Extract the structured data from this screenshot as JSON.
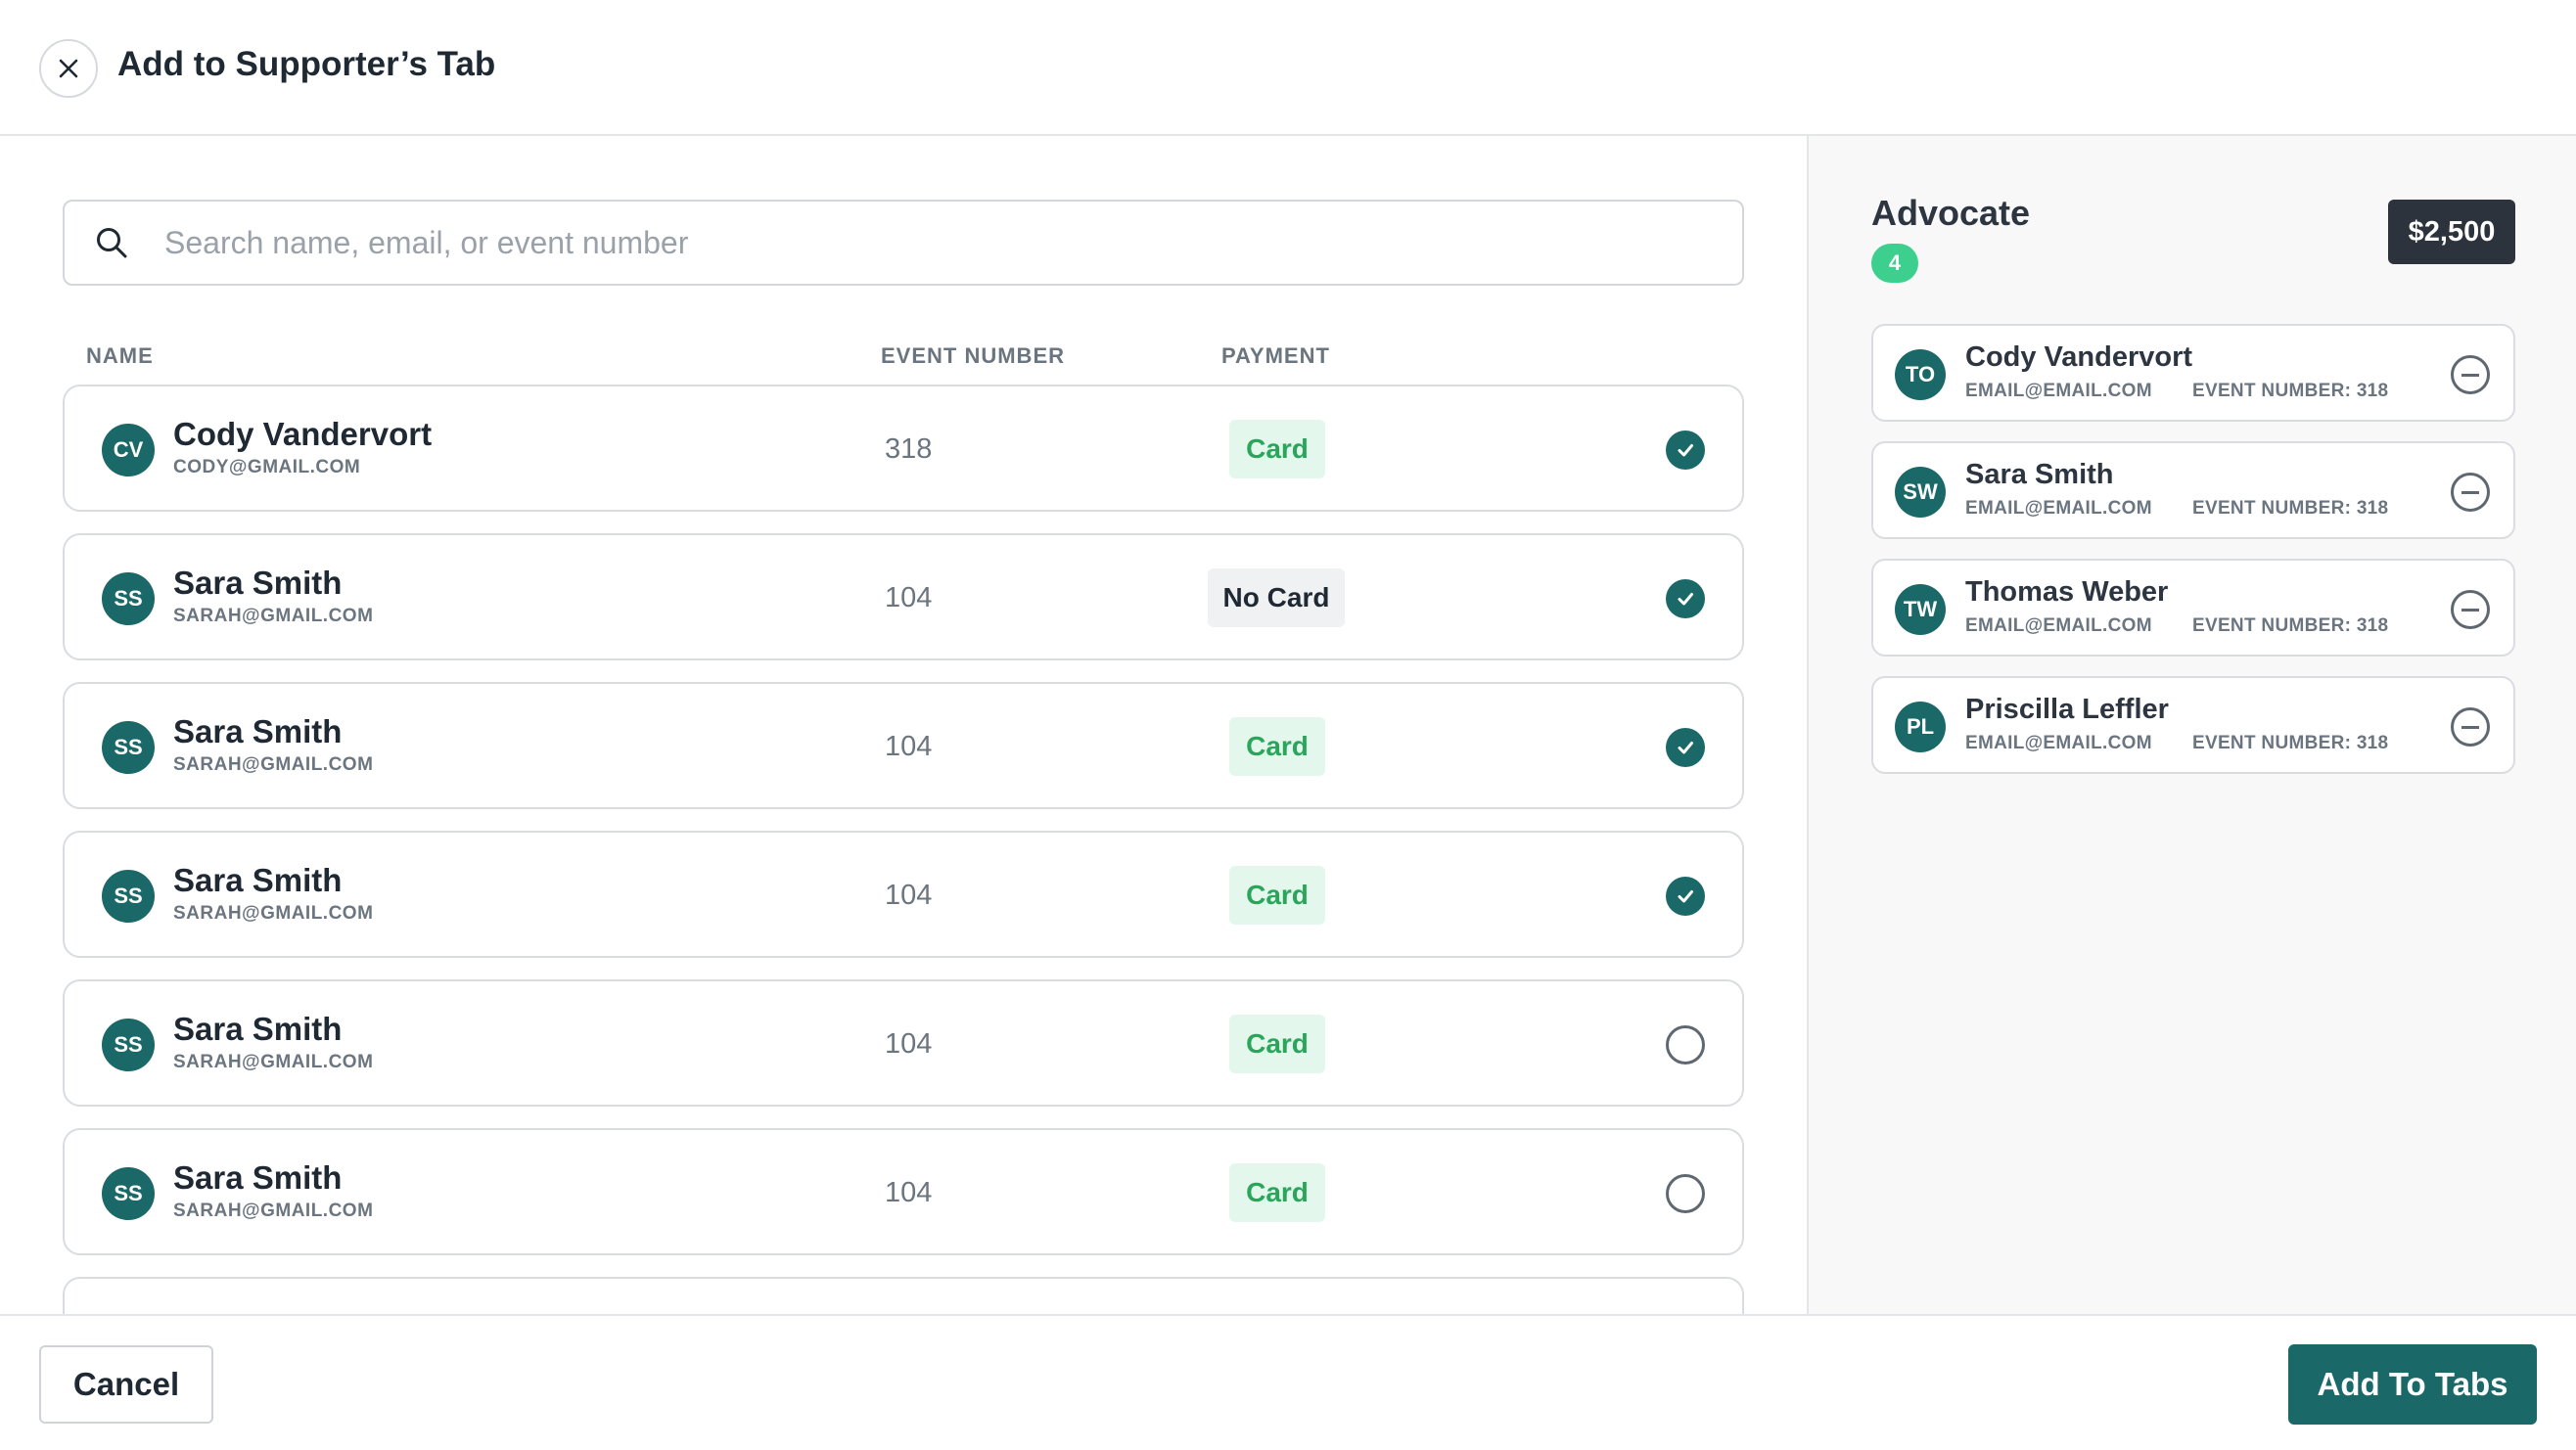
{
  "header": {
    "title": "Add to Supporter’s Tab",
    "close_icon": "close-icon"
  },
  "search": {
    "placeholder": "Search name, email, or event number",
    "value": ""
  },
  "table": {
    "columns": [
      "NAME",
      "EVENT NUMBER",
      "PAYMENT"
    ],
    "rows": [
      {
        "initials": "CV",
        "name": "Cody Vandervort",
        "email": "CODY@GMAIL.COM",
        "event_number": "318",
        "payment": "Card",
        "selected": true
      },
      {
        "initials": "SS",
        "name": "Sara Smith",
        "email": "SARAH@GMAIL.COM",
        "event_number": "104",
        "payment": "No Card",
        "selected": true
      },
      {
        "initials": "SS",
        "name": "Sara Smith",
        "email": "SARAH@GMAIL.COM",
        "event_number": "104",
        "payment": "Card",
        "selected": true
      },
      {
        "initials": "SS",
        "name": "Sara Smith",
        "email": "SARAH@GMAIL.COM",
        "event_number": "104",
        "payment": "Card",
        "selected": true
      },
      {
        "initials": "SS",
        "name": "Sara Smith",
        "email": "SARAH@GMAIL.COM",
        "event_number": "104",
        "payment": "Card",
        "selected": false
      },
      {
        "initials": "SS",
        "name": "Sara Smith",
        "email": "SARAH@GMAIL.COM",
        "event_number": "104",
        "payment": "Card",
        "selected": false
      }
    ]
  },
  "tier": {
    "name": "Advocate",
    "count": "4",
    "amount": "$2,500",
    "members": [
      {
        "initials": "TO",
        "name": "Cody Vandervort",
        "email": "EMAIL@EMAIL.COM",
        "event_number": "EVENT NUMBER: 318"
      },
      {
        "initials": "SW",
        "name": "Sara Smith",
        "email": "EMAIL@EMAIL.COM",
        "event_number": "EVENT NUMBER: 318"
      },
      {
        "initials": "TW",
        "name": "Thomas Weber",
        "email": "EMAIL@EMAIL.COM",
        "event_number": "EVENT NUMBER: 318"
      },
      {
        "initials": "PL",
        "name": "Priscilla Leffler",
        "email": "EMAIL@EMAIL.COM",
        "event_number": "EVENT NUMBER: 318"
      }
    ]
  },
  "footer": {
    "cancel_label": "Cancel",
    "submit_label": "Add To Tabs"
  },
  "colors": {
    "accent": "#1b6868",
    "card_badge_bg": "#e3f7ec",
    "card_badge_text": "#2aa65a",
    "count_badge": "#3ccf8e",
    "amount_badge": "#2c333d"
  }
}
